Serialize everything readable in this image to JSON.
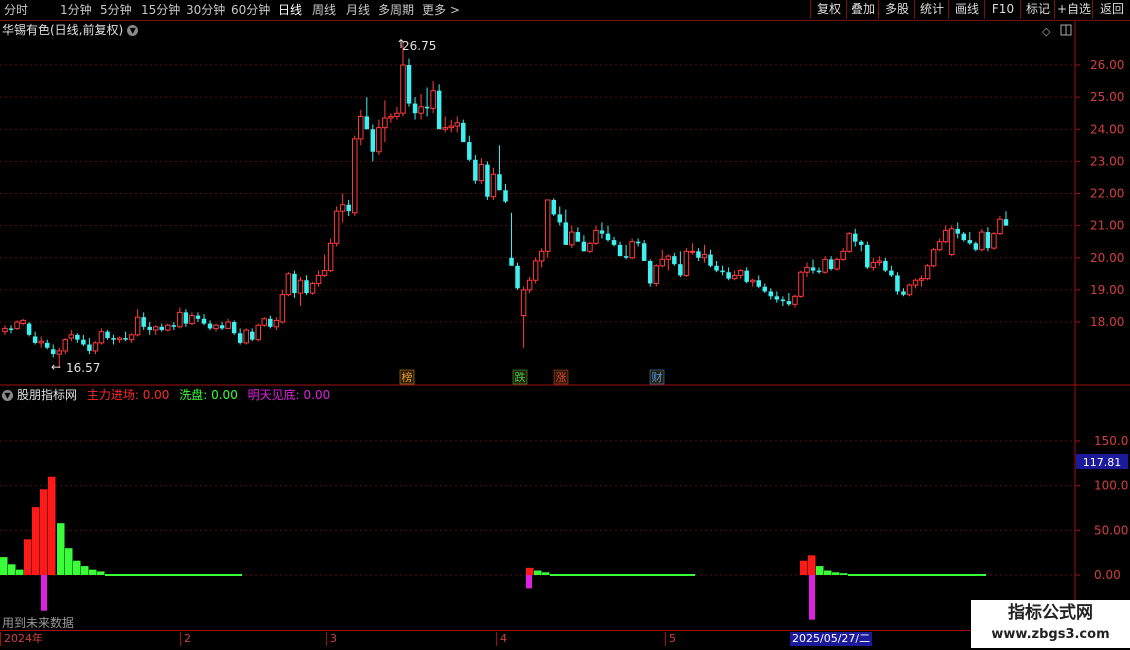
{
  "toolbar": {
    "periods": [
      "分时",
      "1分钟",
      "5分钟",
      "15分钟",
      "30分钟",
      "60分钟",
      "日线",
      "周线",
      "月线",
      "多周期",
      "更多 >"
    ],
    "active_period": "日线",
    "right_buttons": [
      "复权",
      "叠加",
      "多股",
      "统计",
      "画线",
      "F10",
      "标记",
      "+自选",
      "返回"
    ]
  },
  "main_chart": {
    "title": "华锡有色(日线,前复权)",
    "price_axis": [
      "26.00",
      "25.00",
      "24.00",
      "23.00",
      "22.00",
      "21.00",
      "20.00",
      "19.00",
      "18.00"
    ],
    "high_label": "26.75",
    "low_label": "16.57",
    "event_markers": [
      {
        "text": "榜",
        "color": "#e8a030"
      },
      {
        "text": "跌",
        "color": "#30d050"
      },
      {
        "text": "涨",
        "color": "#e04040"
      },
      {
        "text": "财",
        "color": "#40a0ff"
      }
    ],
    "candles": [
      [
        17.7,
        17.9,
        17.6,
        17.8
      ],
      [
        17.8,
        17.9,
        17.65,
        17.75
      ],
      [
        17.8,
        18.05,
        17.75,
        18.0
      ],
      [
        17.95,
        18.1,
        17.9,
        18.05
      ],
      [
        17.95,
        18.0,
        17.55,
        17.6
      ],
      [
        17.55,
        17.7,
        17.3,
        17.35
      ],
      [
        17.35,
        17.55,
        17.2,
        17.4
      ],
      [
        17.35,
        17.45,
        17.15,
        17.2
      ],
      [
        17.15,
        17.3,
        16.9,
        17.0
      ],
      [
        17.0,
        17.2,
        16.57,
        17.1
      ],
      [
        17.1,
        17.5,
        17.0,
        17.45
      ],
      [
        17.5,
        17.75,
        17.4,
        17.6
      ],
      [
        17.6,
        17.65,
        17.35,
        17.45
      ],
      [
        17.45,
        17.6,
        17.25,
        17.3
      ],
      [
        17.3,
        17.5,
        17.0,
        17.1
      ],
      [
        17.1,
        17.4,
        17.0,
        17.35
      ],
      [
        17.35,
        17.8,
        17.3,
        17.7
      ],
      [
        17.7,
        17.75,
        17.45,
        17.5
      ],
      [
        17.5,
        17.6,
        17.3,
        17.45
      ],
      [
        17.45,
        17.55,
        17.35,
        17.5
      ],
      [
        17.5,
        17.7,
        17.4,
        17.45
      ],
      [
        17.45,
        17.65,
        17.35,
        17.6
      ],
      [
        17.6,
        18.4,
        17.55,
        18.15
      ],
      [
        18.15,
        18.3,
        17.75,
        17.85
      ],
      [
        17.85,
        18.0,
        17.6,
        17.75
      ],
      [
        17.75,
        17.9,
        17.6,
        17.85
      ],
      [
        17.85,
        17.95,
        17.7,
        17.75
      ],
      [
        17.75,
        17.95,
        17.7,
        17.9
      ],
      [
        17.9,
        18.0,
        17.75,
        17.85
      ],
      [
        17.85,
        18.45,
        17.8,
        18.3
      ],
      [
        18.3,
        18.4,
        17.85,
        17.95
      ],
      [
        17.95,
        18.3,
        17.9,
        18.2
      ],
      [
        18.2,
        18.3,
        18.0,
        18.1
      ],
      [
        18.1,
        18.25,
        17.9,
        17.95
      ],
      [
        17.95,
        18.05,
        17.75,
        17.8
      ],
      [
        17.8,
        17.95,
        17.7,
        17.9
      ],
      [
        17.9,
        18.0,
        17.75,
        17.8
      ],
      [
        17.8,
        18.1,
        17.8,
        18.0
      ],
      [
        18.0,
        18.05,
        17.6,
        17.65
      ],
      [
        17.65,
        17.8,
        17.3,
        17.35
      ],
      [
        17.35,
        17.8,
        17.3,
        17.75
      ],
      [
        17.7,
        17.8,
        17.4,
        17.45
      ],
      [
        17.45,
        17.95,
        17.4,
        17.9
      ],
      [
        17.9,
        18.15,
        17.85,
        18.1
      ],
      [
        18.1,
        18.2,
        17.8,
        17.85
      ],
      [
        17.85,
        18.15,
        17.75,
        18.05
      ],
      [
        18.0,
        19.0,
        17.95,
        18.85
      ],
      [
        18.85,
        19.55,
        18.8,
        19.5
      ],
      [
        19.5,
        19.6,
        18.75,
        18.9
      ],
      [
        18.9,
        19.4,
        18.5,
        19.3
      ],
      [
        19.3,
        19.45,
        18.85,
        18.9
      ],
      [
        18.9,
        19.25,
        18.85,
        19.2
      ],
      [
        19.2,
        19.6,
        19.1,
        19.45
      ],
      [
        19.45,
        20.1,
        19.4,
        19.6
      ],
      [
        19.6,
        20.6,
        19.55,
        20.45
      ],
      [
        20.45,
        21.6,
        20.35,
        21.45
      ],
      [
        21.45,
        22.0,
        21.1,
        21.65
      ],
      [
        21.65,
        21.8,
        21.3,
        21.45
      ],
      [
        21.4,
        23.8,
        21.3,
        23.7
      ],
      [
        23.7,
        24.6,
        23.5,
        24.4
      ],
      [
        24.4,
        25.0,
        24.0,
        24.0
      ],
      [
        24.0,
        24.15,
        23.0,
        23.3
      ],
      [
        23.3,
        24.3,
        23.2,
        24.05
      ],
      [
        24.05,
        24.9,
        23.6,
        24.35
      ],
      [
        24.35,
        24.5,
        24.2,
        24.4
      ],
      [
        24.4,
        24.7,
        24.3,
        24.5
      ],
      [
        24.5,
        26.75,
        24.4,
        26.0
      ],
      [
        26.0,
        26.2,
        24.7,
        24.8
      ],
      [
        24.8,
        25.0,
        24.3,
        24.5
      ],
      [
        24.5,
        25.1,
        24.3,
        24.7
      ],
      [
        24.7,
        25.3,
        24.4,
        24.65
      ],
      [
        24.65,
        25.5,
        24.5,
        25.2
      ],
      [
        25.2,
        25.4,
        24.1,
        24.0
      ],
      [
        24.0,
        24.4,
        23.9,
        24.05
      ],
      [
        24.05,
        24.3,
        23.9,
        24.1
      ],
      [
        24.1,
        24.4,
        23.9,
        24.2
      ],
      [
        24.2,
        24.3,
        23.7,
        23.6
      ],
      [
        23.6,
        23.8,
        23.0,
        23.05
      ],
      [
        23.05,
        23.2,
        22.3,
        22.4
      ],
      [
        22.4,
        23.1,
        22.3,
        22.9
      ],
      [
        22.9,
        23.0,
        21.8,
        21.9
      ],
      [
        21.9,
        22.8,
        21.8,
        22.6
      ],
      [
        22.6,
        23.5,
        22.1,
        22.1
      ],
      [
        22.1,
        22.3,
        21.7,
        21.75
      ],
      [
        20.0,
        21.4,
        19.8,
        19.75
      ],
      [
        19.75,
        19.85,
        19.0,
        19.05
      ],
      [
        18.2,
        19.1,
        17.2,
        19.0
      ],
      [
        19.0,
        19.4,
        18.9,
        19.3
      ],
      [
        19.3,
        20.0,
        19.2,
        19.9
      ],
      [
        19.9,
        20.3,
        19.7,
        20.2
      ],
      [
        20.2,
        21.8,
        20.0,
        21.8
      ],
      [
        21.8,
        21.85,
        21.3,
        21.35
      ],
      [
        21.35,
        21.6,
        21.0,
        21.1
      ],
      [
        21.1,
        21.5,
        20.4,
        20.4
      ],
      [
        20.4,
        21.0,
        20.3,
        20.8
      ],
      [
        20.8,
        20.95,
        20.5,
        20.5
      ],
      [
        20.5,
        20.7,
        20.2,
        20.2
      ],
      [
        20.2,
        20.5,
        20.15,
        20.45
      ],
      [
        20.45,
        21.0,
        20.4,
        20.85
      ],
      [
        20.85,
        21.1,
        20.6,
        20.75
      ],
      [
        20.75,
        21.0,
        20.5,
        20.55
      ],
      [
        20.55,
        20.65,
        20.35,
        20.4
      ],
      [
        20.4,
        20.5,
        20.05,
        20.05
      ],
      [
        20.05,
        20.4,
        19.95,
        20.0
      ],
      [
        20.0,
        20.6,
        19.95,
        20.5
      ],
      [
        20.5,
        20.6,
        20.35,
        20.45
      ],
      [
        20.45,
        20.55,
        19.9,
        19.9
      ],
      [
        19.9,
        19.95,
        19.1,
        19.2
      ],
      [
        19.2,
        19.8,
        19.1,
        19.75
      ],
      [
        19.75,
        20.25,
        19.7,
        19.95
      ],
      [
        19.95,
        20.1,
        19.6,
        20.05
      ],
      [
        20.05,
        20.15,
        19.75,
        19.8
      ],
      [
        19.8,
        20.2,
        19.4,
        19.45
      ],
      [
        19.45,
        20.3,
        19.4,
        20.2
      ],
      [
        20.2,
        20.45,
        20.1,
        20.2
      ],
      [
        20.2,
        20.3,
        19.9,
        20.0
      ],
      [
        20.0,
        20.4,
        19.85,
        20.1
      ],
      [
        20.1,
        20.25,
        19.7,
        19.75
      ],
      [
        19.75,
        19.9,
        19.55,
        19.6
      ],
      [
        19.6,
        19.75,
        19.45,
        19.55
      ],
      [
        19.55,
        19.7,
        19.3,
        19.35
      ],
      [
        19.35,
        19.6,
        19.3,
        19.45
      ],
      [
        19.45,
        19.65,
        19.35,
        19.6
      ],
      [
        19.6,
        19.7,
        19.2,
        19.25
      ],
      [
        19.25,
        19.35,
        19.1,
        19.3
      ],
      [
        19.3,
        19.45,
        19.05,
        19.1
      ],
      [
        19.1,
        19.2,
        18.9,
        18.95
      ],
      [
        18.95,
        19.05,
        18.7,
        18.8
      ],
      [
        18.8,
        18.95,
        18.6,
        18.7
      ],
      [
        18.7,
        18.8,
        18.5,
        18.65
      ],
      [
        18.65,
        18.9,
        18.5,
        18.55
      ],
      [
        18.55,
        18.85,
        18.45,
        18.8
      ],
      [
        18.8,
        19.6,
        18.75,
        19.55
      ],
      [
        19.55,
        19.85,
        19.4,
        19.7
      ],
      [
        19.7,
        19.95,
        19.5,
        19.6
      ],
      [
        19.6,
        19.7,
        19.5,
        19.55
      ],
      [
        19.55,
        20.05,
        19.5,
        19.95
      ],
      [
        19.95,
        20.05,
        19.6,
        19.65
      ],
      [
        19.65,
        20.0,
        19.6,
        19.95
      ],
      [
        19.95,
        20.3,
        19.9,
        20.2
      ],
      [
        20.2,
        20.8,
        20.15,
        20.75
      ],
      [
        20.75,
        20.9,
        20.35,
        20.5
      ],
      [
        20.5,
        20.55,
        20.2,
        20.4
      ],
      [
        20.4,
        20.5,
        19.65,
        19.7
      ],
      [
        19.7,
        20.0,
        19.6,
        19.85
      ],
      [
        19.85,
        20.05,
        19.75,
        19.9
      ],
      [
        19.9,
        20.0,
        19.55,
        19.6
      ],
      [
        19.6,
        19.75,
        19.4,
        19.45
      ],
      [
        19.45,
        19.55,
        18.85,
        18.95
      ],
      [
        18.95,
        19.05,
        18.8,
        18.85
      ],
      [
        18.85,
        19.2,
        18.8,
        19.15
      ],
      [
        19.15,
        19.35,
        19.05,
        19.3
      ],
      [
        19.3,
        19.45,
        19.1,
        19.35
      ],
      [
        19.35,
        19.8,
        19.3,
        19.75
      ],
      [
        19.75,
        20.3,
        19.7,
        20.25
      ],
      [
        20.25,
        20.6,
        20.2,
        20.5
      ],
      [
        20.5,
        21.0,
        20.45,
        20.85
      ],
      [
        20.1,
        21.0,
        20.05,
        20.9
      ],
      [
        20.9,
        21.1,
        20.6,
        20.75
      ],
      [
        20.75,
        20.8,
        20.5,
        20.55
      ],
      [
        20.55,
        20.8,
        20.4,
        20.45
      ],
      [
        20.45,
        20.5,
        20.2,
        20.25
      ],
      [
        20.25,
        20.9,
        20.2,
        20.8
      ],
      [
        20.8,
        20.95,
        20.2,
        20.3
      ],
      [
        20.3,
        20.8,
        20.25,
        20.75
      ],
      [
        20.75,
        21.3,
        20.7,
        21.2
      ],
      [
        21.2,
        21.45,
        21.0,
        21.0
      ]
    ]
  },
  "indicator": {
    "name": "股朋指标网",
    "params": [
      {
        "label": "主力进场: 0.00",
        "color": "#ff2a2a"
      },
      {
        "label": "洗盘: 0.00",
        "color": "#39ff39"
      },
      {
        "label": "明天见底: 0.00",
        "color": "#e020e0"
      }
    ],
    "axis": [
      "150.0",
      "100.0",
      "50.00",
      "0.00"
    ],
    "cursor_value": "117.81",
    "note": "用到未来数据",
    "bars": [
      {
        "values": [
          20,
          12,
          6,
          40,
          76,
          96,
          110
        ],
        "colors": [
          "#39ff39",
          "#39ff39",
          "#39ff39",
          "#ff1a1a",
          "#ff1a1a",
          "#ff1a1a",
          "#ff1a1a"
        ]
      },
      {
        "values": [
          58,
          30,
          16,
          10,
          6,
          4
        ],
        "colors": [
          "#39ff39",
          "#39ff39",
          "#39ff39",
          "#39ff39",
          "#39ff39",
          "#39ff39"
        ]
      },
      {
        "values": [
          8,
          5,
          3
        ],
        "colors": [
          "#ff1a1a",
          "#39ff39",
          "#39ff39"
        ]
      },
      {
        "values": [
          16,
          22,
          10,
          5,
          3,
          2
        ],
        "colors": [
          "#ff1a1a",
          "#ff1a1a",
          "#39ff39",
          "#39ff39",
          "#39ff39",
          "#39ff39"
        ]
      }
    ],
    "bottom_signals": [
      {
        "value": -40
      },
      {
        "value": -15
      },
      {
        "value": -50
      }
    ]
  },
  "date_axis": {
    "ticks": [
      "2024年",
      "2",
      "3",
      "4",
      "5"
    ],
    "cursor_date": "2025/05/27/二"
  },
  "watermark": {
    "line1": "指标公式网",
    "line2": "www.zbgs3.com"
  }
}
